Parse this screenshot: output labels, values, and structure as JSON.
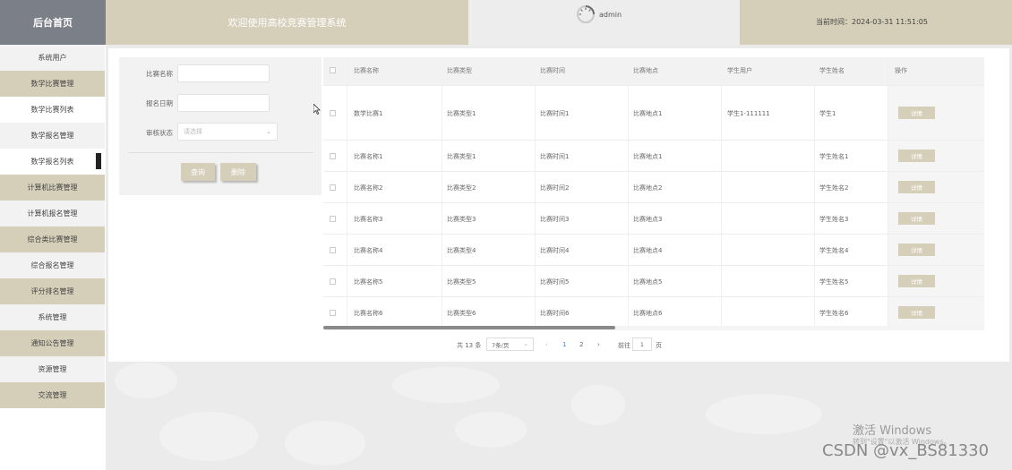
{
  "header": {
    "brand": "后台首页",
    "title": "欢迎使用高校竞赛管理系统",
    "username": "admin",
    "time_label": "当前时间：2024-03-31 11:51:05"
  },
  "sidebar": {
    "items": [
      {
        "label": "系统用户"
      },
      {
        "label": "数学比赛管理"
      },
      {
        "label": "数学比赛列表"
      },
      {
        "label": "数学报名管理"
      },
      {
        "label": "数学报名列表"
      },
      {
        "label": "计算机比赛管理"
      },
      {
        "label": "计算机报名管理"
      },
      {
        "label": "综合类比赛管理"
      },
      {
        "label": "综合报名管理"
      },
      {
        "label": "评分排名管理"
      },
      {
        "label": "系统管理"
      },
      {
        "label": "通知公告管理"
      },
      {
        "label": "资源管理"
      },
      {
        "label": "交流管理"
      }
    ]
  },
  "search": {
    "name_label": "比赛名称",
    "date_label": "报名日期",
    "status_label": "审核状态",
    "status_placeholder": "请选择",
    "query_button": "查询",
    "delete_button": "删除"
  },
  "table": {
    "columns": [
      "比赛名称",
      "比赛类型",
      "比赛时间",
      "比赛地点",
      "学生用户",
      "学生姓名",
      "操作"
    ],
    "detail_label": "详情",
    "rows": [
      [
        "数学比赛1",
        "比赛类型1",
        "比赛时间1",
        "比赛地点1",
        "学生1-111111",
        "学生1"
      ],
      [
        "比赛名称1",
        "比赛类型1",
        "比赛时间1",
        "比赛地点1",
        "",
        "学生姓名1"
      ],
      [
        "比赛名称2",
        "比赛类型2",
        "比赛时间2",
        "比赛地点2",
        "",
        "学生姓名2"
      ],
      [
        "比赛名称3",
        "比赛类型3",
        "比赛时间3",
        "比赛地点3",
        "",
        "学生姓名3"
      ],
      [
        "比赛名称4",
        "比赛类型4",
        "比赛时间4",
        "比赛地点4",
        "",
        "学生姓名4"
      ],
      [
        "比赛名称5",
        "比赛类型5",
        "比赛时间5",
        "比赛地点5",
        "",
        "学生姓名5"
      ],
      [
        "比赛名称6",
        "比赛类型6",
        "比赛时间6",
        "比赛地点6",
        "",
        "学生姓名6"
      ]
    ]
  },
  "pagination": {
    "total": "共 13 条",
    "page_size": "7条/页",
    "prev": "‹",
    "pages": [
      "1",
      "2"
    ],
    "next": "›",
    "goto_label": "前往",
    "goto_value": "1",
    "page_unit": "页"
  },
  "watermark": {
    "line1": "激活 Windows",
    "line2": "转到\"设置\"以激活 Windows。",
    "csdn": "CSDN @vx_BS81330"
  },
  "colors": {
    "accent": "#d5ceb9",
    "brand_bg": "#7b7f88",
    "active_page": "#3c8dde"
  }
}
